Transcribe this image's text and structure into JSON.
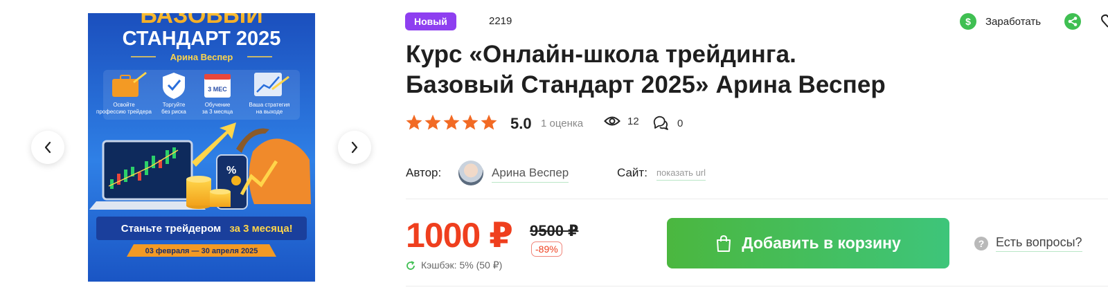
{
  "gallery": {
    "prev_icon": "chevron-left-icon",
    "next_icon": "chevron-right-icon",
    "cover": {
      "headline_line1": "БАЗОВЫЙ",
      "headline_line2": "СТАНДАРТ 2025",
      "author": "Арина Веспер",
      "features": [
        {
          "icon": "briefcase-icon",
          "text": "Освойте профессию трейдера"
        },
        {
          "icon": "shield-check-icon",
          "text": "Торгуйте без риска"
        },
        {
          "icon": "calendar-icon",
          "badge": "3 МЕСЯЦА",
          "text": "Обучение за 3 месяца"
        },
        {
          "icon": "chart-icon",
          "text": "Ваша стратегия на выходе"
        }
      ],
      "banner_text": "Станьте трейдером",
      "banner_highlight": "за 3 месяца!",
      "dates": "03 февраля — 30 апреля 2025"
    }
  },
  "header": {
    "badge": "Новый",
    "course_id": "2219",
    "earn_label": "Заработать",
    "earn_icon": "dollar-icon",
    "share_icon": "share-icon",
    "edge_icon": "heart-icon"
  },
  "product": {
    "title_line1": "Курс «Онлайн-школа трейдинга.",
    "title_line2": "Базовый Стандарт 2025» Арина Веспер"
  },
  "stats": {
    "stars": 5,
    "rating": "5.0",
    "rating_count": "1 оценка",
    "views": "12",
    "comments": "0"
  },
  "meta": {
    "author_label": "Автор:",
    "author_name": "Арина Веспер",
    "site_label": "Сайт:",
    "site_link": "показать url"
  },
  "pricing": {
    "price": "1000 ₽",
    "old_price": "9500 ₽",
    "discount": "-89%",
    "cashback": "Кэшбэк: 5% (50 ₽)",
    "cart_button": "Добавить в корзину",
    "questions_label": "Есть вопросы?",
    "questions_mark": "?"
  },
  "colors": {
    "badge": "#8e3ff0",
    "price": "#ef3f1e",
    "star": "#f26a24",
    "accent_green": "#3fbf52"
  }
}
